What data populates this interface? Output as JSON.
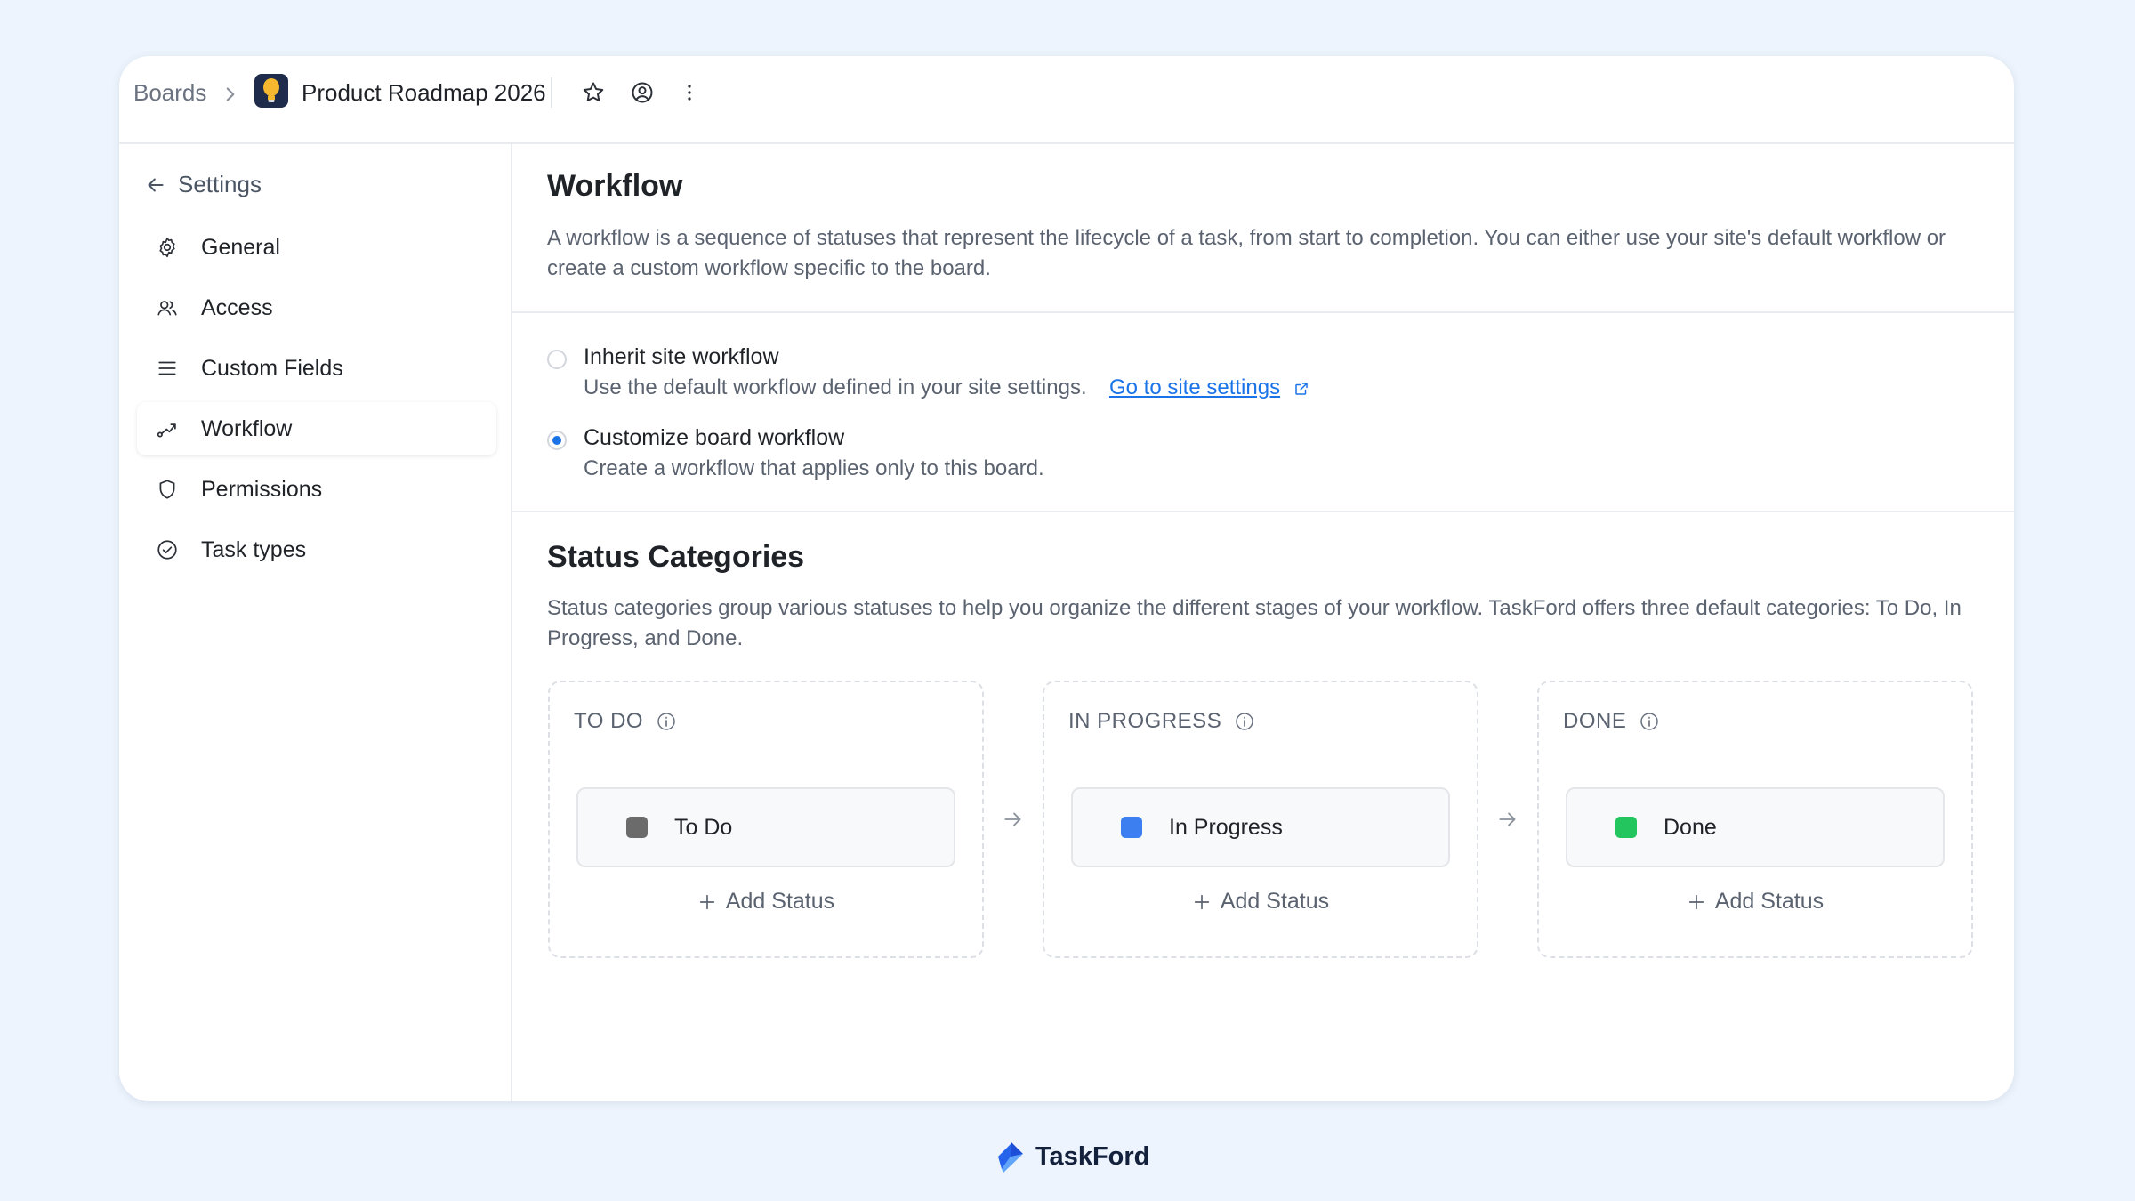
{
  "breadcrumb": {
    "root": "Boards",
    "board_title": "Product Roadmap 2026"
  },
  "sidebar": {
    "back_label": "Settings",
    "items": [
      {
        "label": "General",
        "icon": "gear-icon"
      },
      {
        "label": "Access",
        "icon": "users-icon"
      },
      {
        "label": "Custom Fields",
        "icon": "list-icon"
      },
      {
        "label": "Workflow",
        "icon": "workflow-icon",
        "active": true
      },
      {
        "label": "Permissions",
        "icon": "shield-icon"
      },
      {
        "label": "Task types",
        "icon": "check-circle-icon"
      }
    ]
  },
  "workflow": {
    "title": "Workflow",
    "description": "A workflow is a sequence of statuses that represent the lifecycle of a task, from start to completion. You can either use your site's default workflow or create a custom workflow specific to the board.",
    "options": [
      {
        "title": "Inherit site workflow",
        "subtitle": "Use the default workflow defined in your site settings.",
        "link": "Go to site settings",
        "selected": false
      },
      {
        "title": "Customize board workflow",
        "subtitle": "Create a workflow that applies only to this board.",
        "selected": true
      }
    ]
  },
  "status_categories": {
    "title": "Status Categories",
    "description": "Status categories group various statuses to help you organize the different stages of your workflow. TaskFord offers three default categories: To Do, In Progress, and Done.",
    "add_status_label": "Add Status",
    "categories": [
      {
        "name": "TO DO",
        "status": "To Do",
        "color": "#6b6b6b"
      },
      {
        "name": "IN PROGRESS",
        "status": "In Progress",
        "color": "#3b7ff0"
      },
      {
        "name": "DONE",
        "status": "Done",
        "color": "#22c55e"
      }
    ]
  },
  "brand": {
    "name": "TaskFord"
  },
  "colors": {
    "accent": "#1a73e8",
    "background": "#edf4fd"
  }
}
